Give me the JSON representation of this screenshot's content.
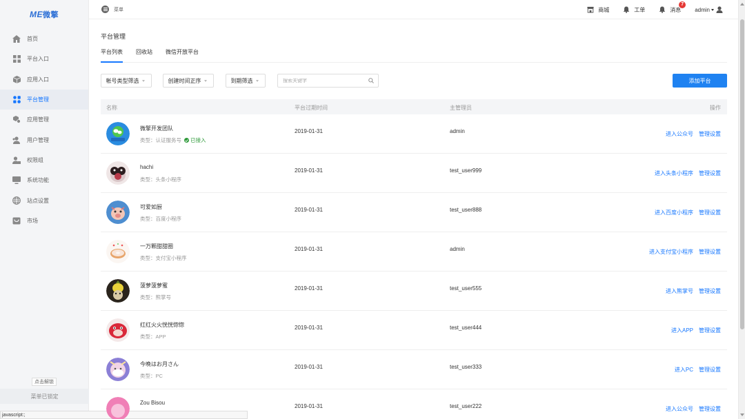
{
  "logo": {
    "brand": "ME",
    "text": "微擎"
  },
  "sidebar": {
    "items": [
      {
        "label": "首页",
        "icon": "home-icon"
      },
      {
        "label": "平台入口",
        "icon": "grid-icon"
      },
      {
        "label": "应用入口",
        "icon": "cube-icon"
      },
      {
        "label": "平台管理",
        "icon": "apps-icon",
        "active": true
      },
      {
        "label": "应用管理",
        "icon": "gear-box-icon"
      },
      {
        "label": "用户管理",
        "icon": "users-icon"
      },
      {
        "label": "权限组",
        "icon": "user-lock-icon"
      },
      {
        "label": "系统功能",
        "icon": "monitor-icon"
      },
      {
        "label": "站点设置",
        "icon": "globe-icon"
      },
      {
        "label": "市场",
        "icon": "shop-icon"
      }
    ],
    "unlock_label": "点击解锁",
    "locked_label": "菜单已锁定"
  },
  "statusbar": "javascript:;",
  "topbar": {
    "menu_label": "菜单",
    "shop_label": "商城",
    "ticket_label": "工单",
    "message_label": "消息",
    "message_badge": "7",
    "user_label": "admin"
  },
  "page": {
    "title": "平台管理",
    "tabs": [
      "平台列表",
      "回收站",
      "微信开放平台"
    ]
  },
  "filters": {
    "account_type": "帐号类型筛选",
    "create_time": "创建时间正序",
    "expiry": "到期筛选",
    "search_placeholder": "搜索关键字",
    "add_button": "添加平台"
  },
  "table": {
    "headers": {
      "name": "名称",
      "expiry": "平台过期时间",
      "admin": "主管理员",
      "ops": "操作"
    },
    "rows": [
      {
        "name": "微擎开发团队",
        "type": "类型：认证服务号",
        "status": "已接入",
        "expiry": "2019-01-31",
        "admin": "admin",
        "enter": "进入公众号",
        "manage": "管理设置",
        "avatar": "wechat"
      },
      {
        "name": "hachi",
        "type": "类型：头条小程序",
        "expiry": "2019-01-31",
        "admin": "test_user999",
        "enter": "进入头条小程序",
        "manage": "管理设置",
        "avatar": "cat"
      },
      {
        "name": "可爱如厨",
        "type": "类型：百度小程序",
        "expiry": "2019-01-31",
        "admin": "test_user888",
        "enter": "进入百度小程序",
        "manage": "管理设置",
        "avatar": "pig"
      },
      {
        "name": "一万颗甜甜圈",
        "type": "类型：支付宝小程序",
        "expiry": "2019-01-31",
        "admin": "admin",
        "enter": "进入支付宝小程序",
        "manage": "管理设置",
        "avatar": "donut"
      },
      {
        "name": "菠萝菠萝蜜",
        "type": "类型：熊掌号",
        "expiry": "2019-01-31",
        "admin": "test_user555",
        "enter": "进入熊掌号",
        "manage": "管理设置",
        "avatar": "pineapple"
      },
      {
        "name": "红红火火恍恍惚惚",
        "type": "类型：APP",
        "expiry": "2019-01-31",
        "admin": "test_user444",
        "enter": "进入APP",
        "manage": "管理设置",
        "avatar": "red"
      },
      {
        "name": "今晚はお月さん",
        "type": "类型：PC",
        "expiry": "2019-01-31",
        "admin": "test_user333",
        "enter": "进入PC",
        "manage": "管理设置",
        "avatar": "moon"
      },
      {
        "name": "Zou Bisou",
        "type": "",
        "expiry": "2019-01-31",
        "admin": "test_user222",
        "enter": "进入公众号",
        "manage": "管理设置",
        "avatar": "pink"
      }
    ]
  },
  "colors": {
    "accent": "#1677ff",
    "button": "#1f82f1",
    "success": "#2e9a3a",
    "badge": "#e53935"
  }
}
